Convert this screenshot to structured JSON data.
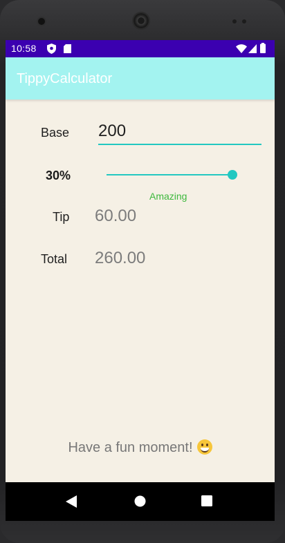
{
  "status_bar": {
    "time": "10:58",
    "background_color": "#3b00b0",
    "icons": [
      "shield-notification-icon",
      "sim-card-icon",
      "wifi-icon",
      "cell-signal-icon",
      "battery-icon"
    ]
  },
  "app_bar": {
    "title": "TippyCalculator",
    "background_color": "#a3f3f0"
  },
  "form": {
    "base_label": "Base",
    "base_value": "200",
    "tip_percent_label": "30%",
    "tip_percent_value": 30,
    "slider_level": 1.0,
    "rating_text": "Amazing",
    "rating_color": "#3cb83c",
    "accent_color": "#22c8c1",
    "tip_label": "Tip",
    "tip_amount": "60.00",
    "total_label": "Total",
    "total_amount": "260.00"
  },
  "footer": {
    "message": "Have a fun moment!",
    "emoji_icon": "grinning-face-icon"
  },
  "nav_bar": {
    "buttons": [
      "back-icon",
      "home-icon",
      "recents-icon"
    ]
  }
}
